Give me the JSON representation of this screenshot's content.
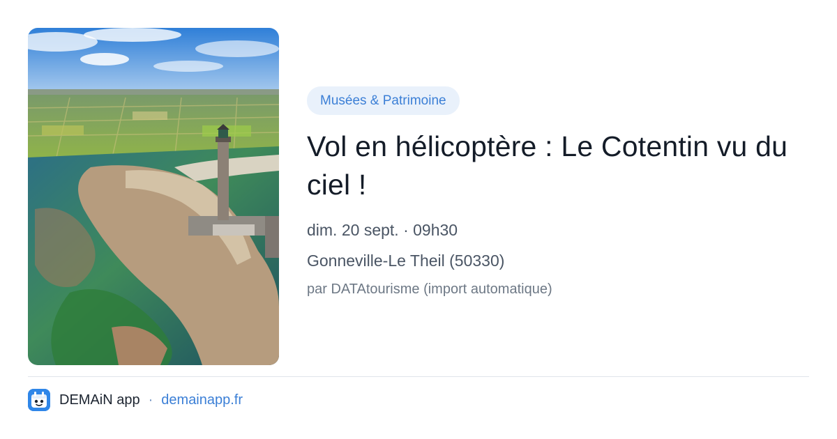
{
  "event": {
    "category": "Musées & Patrimoine",
    "title": "Vol en hélicoptère : Le Cotentin vu du ciel !",
    "date_time": "dim. 20 sept. · 09h30",
    "location": "Gonneville-Le Theil (50330)",
    "source": "par DATAtourisme (import automatique)",
    "image_icon": "aerial-lighthouse-coast-photo"
  },
  "footer": {
    "app_name": "DEMAiN app",
    "separator": "·",
    "url": "demainapp.fr",
    "logo_icon": "demain-app-logo-icon"
  },
  "colors": {
    "accent": "#3b7fd6",
    "badge_bg": "#e9f1fb",
    "app_icon_bg": "#2f86e8"
  }
}
